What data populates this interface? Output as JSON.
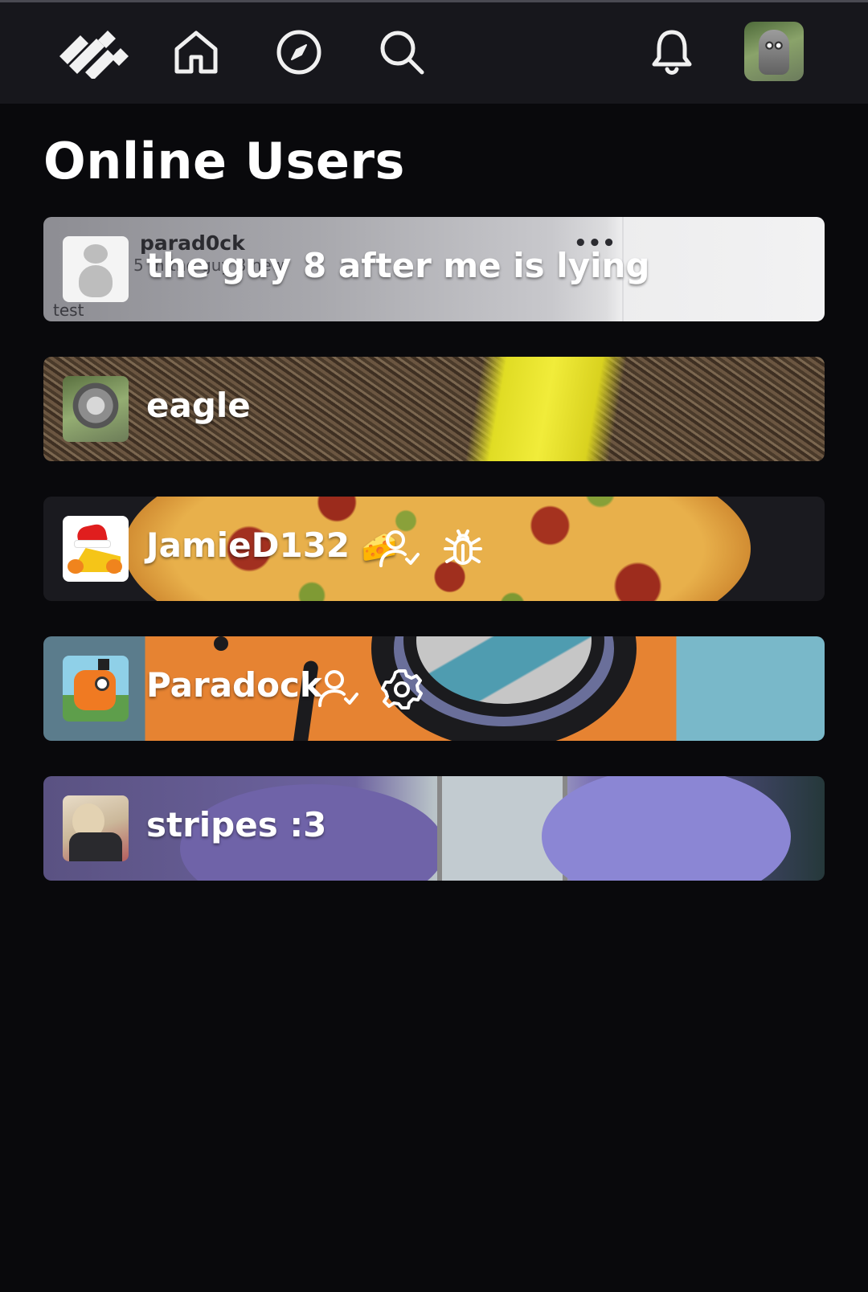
{
  "nav": {
    "logo_icon": "app-logo-icon",
    "items": [
      {
        "icon": "home-icon"
      },
      {
        "icon": "compass-icon"
      },
      {
        "icon": "search-icon"
      }
    ],
    "notifications_icon": "bell-icon"
  },
  "page": {
    "title": "Online Users"
  },
  "users": [
    {
      "name": "the guy 8 after me is lying",
      "ghost_name": "parad0ck",
      "ghost_sub": "5 m   the guy 8 new",
      "ghost_text": "test",
      "ghost_menu": "•••",
      "badges": []
    },
    {
      "name": "eagle",
      "badges": []
    },
    {
      "name": "JamieD132",
      "emoji": "🧀",
      "badges": [
        "verified-user-icon",
        "bug-icon"
      ]
    },
    {
      "name": "Paradock",
      "badges": [
        "verified-user-icon",
        "gear-icon"
      ]
    },
    {
      "name": "stripes :3",
      "badges": []
    }
  ],
  "colors": {
    "background": "#09090c",
    "navbar": "#17171c",
    "text": "#ffffff"
  }
}
